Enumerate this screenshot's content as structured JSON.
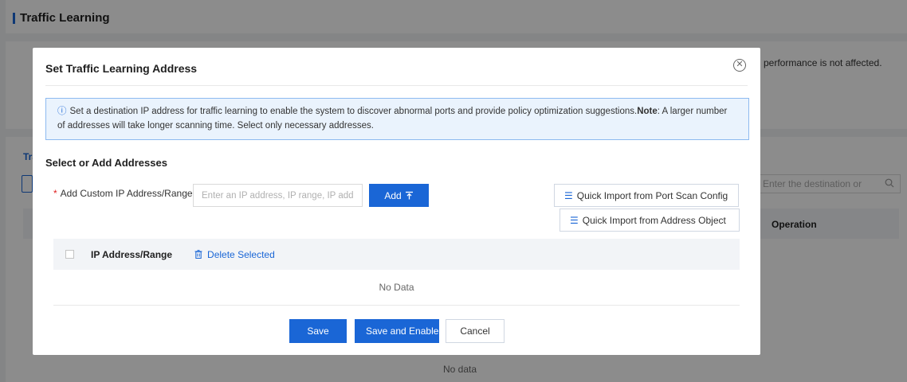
{
  "background": {
    "page_title": "Traffic Learning",
    "notice_text": "performance is not affected.",
    "table_section_title": "Tra",
    "search_placeholder": "Enter the destination or",
    "column_operation": "Operation",
    "no_data": "No data"
  },
  "modal": {
    "title": "Set Traffic Learning Address",
    "info": {
      "text_before": "Set a destination IP address for traffic learning to enable the system to discover abnormal ports and provide policy optimization suggestions.",
      "note_label": "Note",
      "text_after": ": A larger number of addresses will take longer scanning time. Select only necessary addresses."
    },
    "section_title": "Select or Add Addresses",
    "field": {
      "required_mark": "*",
      "label": "Add Custom IP Address/Range",
      "placeholder": "Enter an IP address, IP range, IP address/mask",
      "value": ""
    },
    "add_button": "Add",
    "quick_import_port": "Quick Import from Port Scan Config",
    "quick_import_address": "Quick Import from Address Object",
    "table": {
      "column_ip": "IP Address/Range",
      "delete_selected": "Delete Selected",
      "empty": "No Data"
    },
    "buttons": {
      "save": "Save",
      "save_enable": "Save and Enable Now",
      "cancel": "Cancel"
    }
  },
  "colors": {
    "primary": "#1a66d6",
    "info_bg": "#eaf3fd",
    "info_border": "#8dbaf0",
    "required": "#e02020"
  },
  "icons": [
    "info-circle-icon",
    "close-circle-icon",
    "upload-icon",
    "import-list-icon",
    "trash-icon",
    "search-icon",
    "checkbox-icon"
  ]
}
